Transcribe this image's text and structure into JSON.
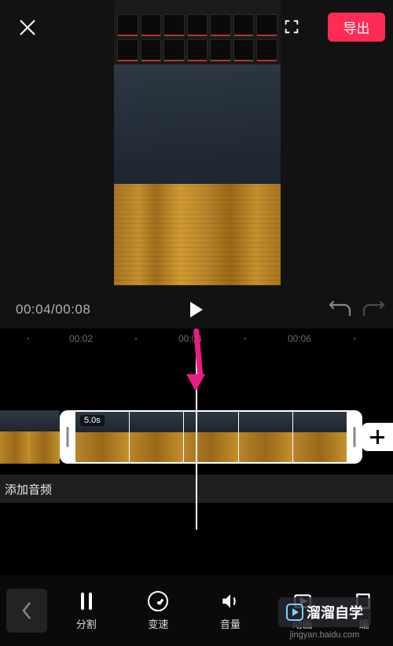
{
  "top": {
    "export_label": "导出"
  },
  "transport": {
    "cur": "00:04",
    "total": "00:08"
  },
  "ruler": {
    "marks": [
      "00:02",
      "00:04",
      "00:06"
    ]
  },
  "clip": {
    "duration_badge": "5.0s"
  },
  "audio_row": {
    "label": "添加音频"
  },
  "tools": {
    "items": [
      {
        "key": "split",
        "label": "分割"
      },
      {
        "key": "speed",
        "label": "变速"
      },
      {
        "key": "volume",
        "label": "音量"
      },
      {
        "key": "anim",
        "label": "动画"
      },
      {
        "key": "edit",
        "label": "编"
      }
    ]
  },
  "watermark": {
    "brand": "溜溜自学",
    "url": "jingyan.baidu.com"
  }
}
